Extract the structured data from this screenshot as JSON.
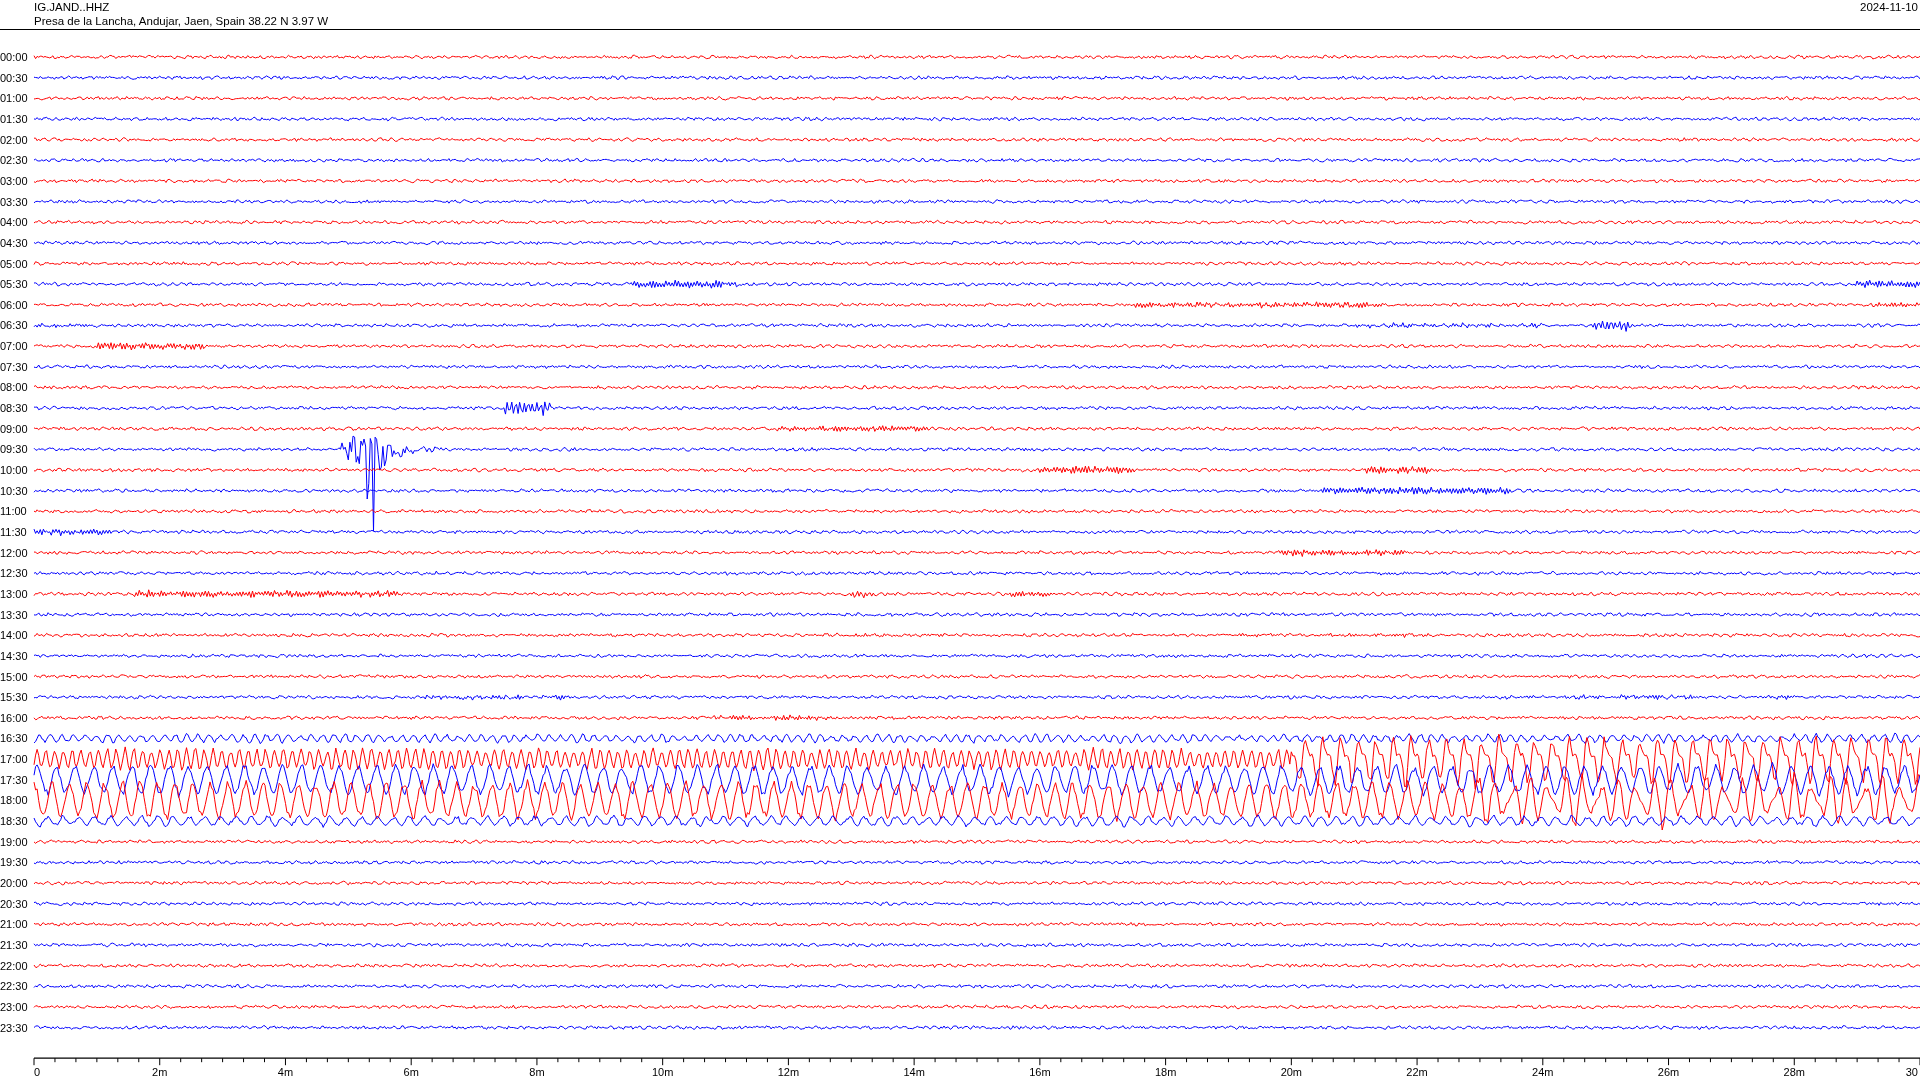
{
  "header": {
    "station": "IG.JAND..HHZ",
    "location": "Presa de la Lancha, Andujar, Jaen, Spain  38.22 N 3.97 W",
    "date": "2024-11-10"
  },
  "rows": [
    {
      "label": "00:00",
      "color": "#ff0000"
    },
    {
      "label": "00:30",
      "color": "#0000ff"
    },
    {
      "label": "01:00",
      "color": "#ff0000"
    },
    {
      "label": "01:30",
      "color": "#0000ff"
    },
    {
      "label": "02:00",
      "color": "#ff0000"
    },
    {
      "label": "02:30",
      "color": "#0000ff"
    },
    {
      "label": "03:00",
      "color": "#ff0000"
    },
    {
      "label": "03:30",
      "color": "#0000ff"
    },
    {
      "label": "04:00",
      "color": "#ff0000"
    },
    {
      "label": "04:30",
      "color": "#0000ff"
    },
    {
      "label": "05:00",
      "color": "#ff0000"
    },
    {
      "label": "05:30",
      "color": "#0000ff"
    },
    {
      "label": "06:00",
      "color": "#ff0000"
    },
    {
      "label": "06:30",
      "color": "#0000ff"
    },
    {
      "label": "07:00",
      "color": "#ff0000"
    },
    {
      "label": "07:30",
      "color": "#0000ff"
    },
    {
      "label": "08:00",
      "color": "#ff0000"
    },
    {
      "label": "08:30",
      "color": "#0000ff"
    },
    {
      "label": "09:00",
      "color": "#ff0000"
    },
    {
      "label": "09:30",
      "color": "#0000ff"
    },
    {
      "label": "10:00",
      "color": "#ff0000"
    },
    {
      "label": "10:30",
      "color": "#0000ff"
    },
    {
      "label": "11:00",
      "color": "#ff0000"
    },
    {
      "label": "11:30",
      "color": "#0000ff"
    },
    {
      "label": "12:00",
      "color": "#ff0000"
    },
    {
      "label": "12:30",
      "color": "#0000ff"
    },
    {
      "label": "13:00",
      "color": "#ff0000"
    },
    {
      "label": "13:30",
      "color": "#0000ff"
    },
    {
      "label": "14:00",
      "color": "#ff0000"
    },
    {
      "label": "14:30",
      "color": "#0000ff"
    },
    {
      "label": "15:00",
      "color": "#ff0000"
    },
    {
      "label": "15:30",
      "color": "#0000ff"
    },
    {
      "label": "16:00",
      "color": "#ff0000"
    },
    {
      "label": "16:30",
      "color": "#0000ff"
    },
    {
      "label": "17:00",
      "color": "#ff0000"
    },
    {
      "label": "17:30",
      "color": "#0000ff"
    },
    {
      "label": "18:00",
      "color": "#ff0000"
    },
    {
      "label": "18:30",
      "color": "#0000ff"
    },
    {
      "label": "19:00",
      "color": "#ff0000"
    },
    {
      "label": "19:30",
      "color": "#0000ff"
    },
    {
      "label": "20:00",
      "color": "#ff0000"
    },
    {
      "label": "20:30",
      "color": "#0000ff"
    },
    {
      "label": "21:00",
      "color": "#ff0000"
    },
    {
      "label": "21:30",
      "color": "#0000ff"
    },
    {
      "label": "22:00",
      "color": "#ff0000"
    },
    {
      "label": "22:30",
      "color": "#0000ff"
    },
    {
      "label": "23:00",
      "color": "#ff0000"
    },
    {
      "label": "23:30",
      "color": "#0000ff"
    }
  ],
  "x_axis": {
    "ticks": [
      {
        "label": "0"
      },
      {
        "label": "2m"
      },
      {
        "label": "4m"
      },
      {
        "label": "6m"
      },
      {
        "label": "8m"
      },
      {
        "label": "10m"
      },
      {
        "label": "12m"
      },
      {
        "label": "14m"
      },
      {
        "label": "16m"
      },
      {
        "label": "18m"
      },
      {
        "label": "20m"
      },
      {
        "label": "22m"
      },
      {
        "label": "24m"
      },
      {
        "label": "26m"
      },
      {
        "label": "28m"
      },
      {
        "label": "30"
      }
    ]
  }
}
